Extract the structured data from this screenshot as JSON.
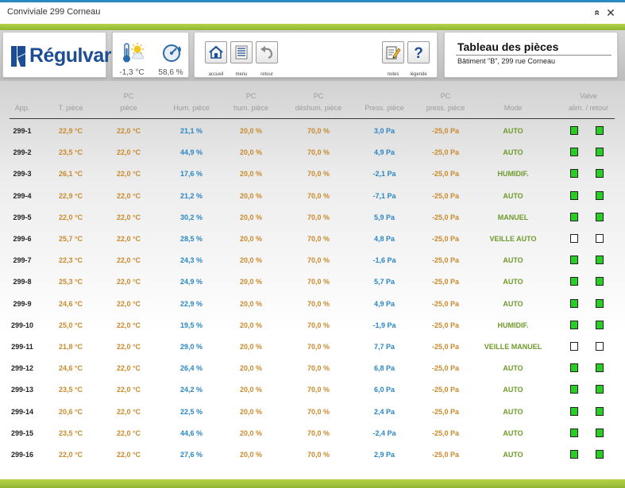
{
  "window": {
    "title": "Conviviale 299 Corneau",
    "collapse_glyph": "«",
    "close_glyph": "✕"
  },
  "logo": {
    "text": "Régulvar",
    "color": "#1d4e93"
  },
  "weather": {
    "temperature": "-1,3 °C",
    "humidity": "58,6 %"
  },
  "nav": {
    "accueil": "accueil",
    "menu": "menu",
    "retour": "retour",
    "notes": "notes",
    "legende": "légende"
  },
  "info": {
    "title": "Tableau des pièces",
    "subtitle": "Bâtiment \"B\", 299 rue Corneau"
  },
  "table": {
    "headers": {
      "app": "App.",
      "t_piece": "T. pièce",
      "pc_piece_1": "PC",
      "pc_piece_2": "pièce",
      "hum_piece": "Hum. pièce",
      "pc_hum_1": "PC",
      "pc_hum_2": "hum. pièce",
      "pc_deshum_1": "PC",
      "pc_deshum_2": "déshum. pièce",
      "press_piece": "Press. pièce",
      "pc_press_1": "PC",
      "pc_press_2": "press. pièce",
      "mode": "Mode",
      "valve_1": "Valve",
      "valve_2": "alim. / retour"
    },
    "rows": [
      {
        "app": "299-1",
        "t": "22,9 °C",
        "pc": "22,0 °C",
        "hum": "21,1 %",
        "pch": "20,0 %",
        "pcd": "70,0 %",
        "press": "3,0 Pa",
        "pcp": "-25,0 Pa",
        "mode": "AUTO",
        "v1": true,
        "v2": true
      },
      {
        "app": "299-2",
        "t": "23,5 °C",
        "pc": "22,0 °C",
        "hum": "44,9 %",
        "pch": "20,0 %",
        "pcd": "70,0 %",
        "press": "4,9 Pa",
        "pcp": "-25,0 Pa",
        "mode": "AUTO",
        "v1": true,
        "v2": true
      },
      {
        "app": "299-3",
        "t": "26,1 °C",
        "pc": "22,0 °C",
        "hum": "17,6 %",
        "pch": "20,0 %",
        "pcd": "70,0 %",
        "press": "-2,1 Pa",
        "pcp": "-25,0 Pa",
        "mode": "HUMIDIF.",
        "v1": true,
        "v2": true
      },
      {
        "app": "299-4",
        "t": "22,9 °C",
        "pc": "22,0 °C",
        "hum": "21,2 %",
        "pch": "20,0 %",
        "pcd": "70,0 %",
        "press": "-7,1 Pa",
        "pcp": "-25,0 Pa",
        "mode": "AUTO",
        "v1": true,
        "v2": true
      },
      {
        "app": "299-5",
        "t": "22,0 °C",
        "pc": "22,0 °C",
        "hum": "30,2 %",
        "pch": "20,0 %",
        "pcd": "70,0 %",
        "press": "5,9 Pa",
        "pcp": "-25,0 Pa",
        "mode": "MANUEL",
        "v1": true,
        "v2": true
      },
      {
        "app": "299-6",
        "t": "25,7 °C",
        "pc": "22,0 °C",
        "hum": "28,5 %",
        "pch": "20,0 %",
        "pcd": "70,0 %",
        "press": "4,8 Pa",
        "pcp": "-25,0 Pa",
        "mode": "VEILLE AUTO",
        "v1": false,
        "v2": false
      },
      {
        "app": "299-7",
        "t": "22,3 °C",
        "pc": "22,0 °C",
        "hum": "24,3 %",
        "pch": "20,0 %",
        "pcd": "70,0 %",
        "press": "-1,6 Pa",
        "pcp": "-25,0 Pa",
        "mode": "AUTO",
        "v1": true,
        "v2": true
      },
      {
        "app": "299-8",
        "t": "25,3 °C",
        "pc": "22,0 °C",
        "hum": "24,9 %",
        "pch": "20,0 %",
        "pcd": "70,0 %",
        "press": "5,7 Pa",
        "pcp": "-25,0 Pa",
        "mode": "AUTO",
        "v1": true,
        "v2": true
      },
      {
        "app": "299-9",
        "t": "24,6 °C",
        "pc": "22,0 °C",
        "hum": "22,9 %",
        "pch": "20,0 %",
        "pcd": "70,0 %",
        "press": "4,9 Pa",
        "pcp": "-25,0 Pa",
        "mode": "AUTO",
        "v1": true,
        "v2": true
      },
      {
        "app": "299-10",
        "t": "25,0 °C",
        "pc": "22,0 °C",
        "hum": "19,5 %",
        "pch": "20,0 %",
        "pcd": "70,0 %",
        "press": "-1,9 Pa",
        "pcp": "-25,0 Pa",
        "mode": "HUMIDIF.",
        "v1": true,
        "v2": true
      },
      {
        "app": "299-11",
        "t": "21,8 °C",
        "pc": "22,0 °C",
        "hum": "29,0 %",
        "pch": "20,0 %",
        "pcd": "70,0 %",
        "press": "7,7 Pa",
        "pcp": "-25,0 Pa",
        "mode": "VEILLE MANUEL",
        "v1": false,
        "v2": false
      },
      {
        "app": "299-12",
        "t": "24,6 °C",
        "pc": "22,0 °C",
        "hum": "26,4 %",
        "pch": "20,0 %",
        "pcd": "70,0 %",
        "press": "6,8 Pa",
        "pcp": "-25,0 Pa",
        "mode": "AUTO",
        "v1": true,
        "v2": true
      },
      {
        "app": "299-13",
        "t": "23,5 °C",
        "pc": "22,0 °C",
        "hum": "24,2 %",
        "pch": "20,0 %",
        "pcd": "70,0 %",
        "press": "6,0 Pa",
        "pcp": "-25,0 Pa",
        "mode": "AUTO",
        "v1": true,
        "v2": true
      },
      {
        "app": "299-14",
        "t": "20,6 °C",
        "pc": "22,0 °C",
        "hum": "22,5 %",
        "pch": "20,0 %",
        "pcd": "70,0 %",
        "press": "2,4 Pa",
        "pcp": "-25,0 Pa",
        "mode": "AUTO",
        "v1": true,
        "v2": true
      },
      {
        "app": "299-15",
        "t": "23,5 °C",
        "pc": "22,0 °C",
        "hum": "44,6 %",
        "pch": "20,0 %",
        "pcd": "70,0 %",
        "press": "-2,4 Pa",
        "pcp": "-25,0 Pa",
        "mode": "AUTO",
        "v1": true,
        "v2": true
      },
      {
        "app": "299-16",
        "t": "22,0 °C",
        "pc": "22,0 °C",
        "hum": "27,6 %",
        "pch": "20,0 %",
        "pcd": "70,0 %",
        "press": "2,9 Pa",
        "pcp": "-25,0 Pa",
        "mode": "AUTO",
        "v1": true,
        "v2": true
      }
    ]
  },
  "colors": {
    "temperature": "#c98a2c",
    "humidity": "#2a86c4",
    "mode": "#6e9a2a",
    "valve_on": "#27cf23",
    "accent_green": "#a9c742",
    "title_bar_accent": "#2c89c0"
  },
  "icons": {
    "weather": "thermometer-sun-icon",
    "humidity": "humidity-gauge-icon",
    "accueil": "home-icon",
    "menu": "menu-list-icon",
    "retour": "back-arrow-icon",
    "notes": "notes-pencil-icon",
    "legende": "question-mark-icon"
  }
}
